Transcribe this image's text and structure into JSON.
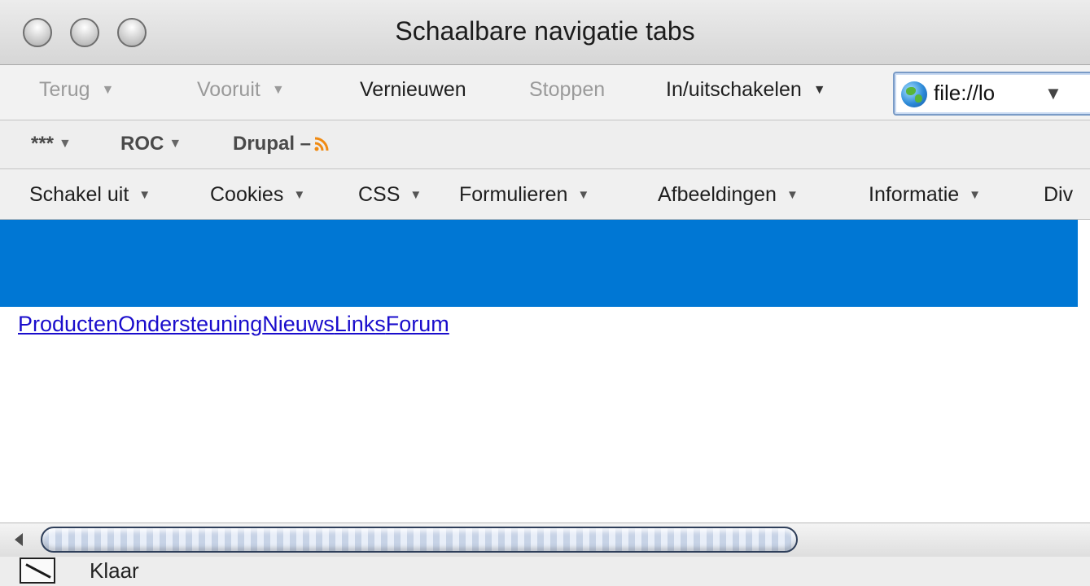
{
  "window": {
    "title": "Schaalbare navigatie tabs"
  },
  "navbar": {
    "back_label": "Terug",
    "forward_label": "Vooruit",
    "reload_label": "Vernieuwen",
    "stop_label": "Stoppen",
    "toggle_label": "In/uitschakelen",
    "url": "file://lo",
    "caret": "▼"
  },
  "bookmarks": {
    "items": [
      "***",
      "ROC",
      "Drupal –"
    ],
    "caret": "▼"
  },
  "devbar": {
    "items": [
      "Schakel uit",
      "Cookies",
      "CSS",
      "Formulieren",
      "Afbeeldingen",
      "Informatie",
      "Div"
    ],
    "caret": "▼"
  },
  "content": {
    "header_color": "#0077d4",
    "links": [
      "Producten",
      "Ondersteuning",
      "Nieuws",
      "Links",
      "Forum"
    ]
  },
  "status": {
    "text": "Klaar"
  },
  "icons": {
    "url": "globe-icon",
    "bookmark_feed": "rss-icon",
    "status": "pen-icon"
  }
}
